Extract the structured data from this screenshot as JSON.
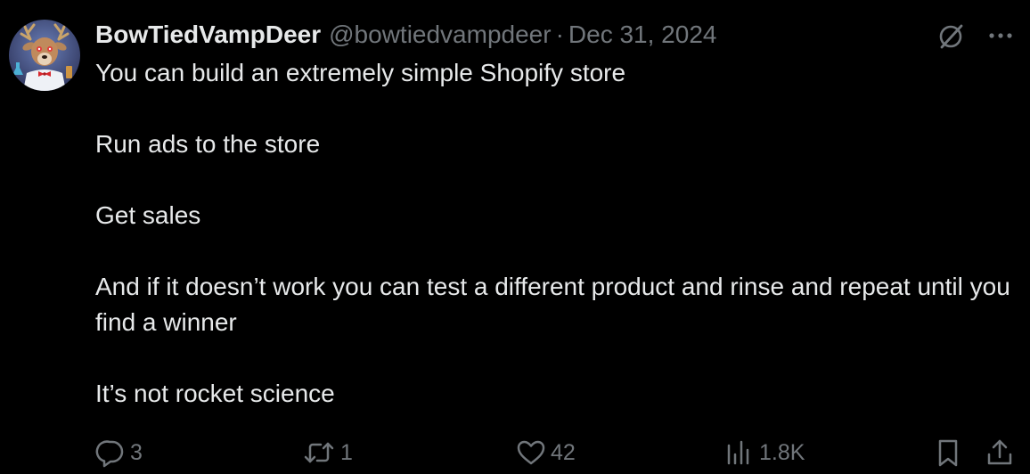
{
  "author": {
    "display_name": "BowTiedVampDeer",
    "handle": "@bowtiedvampdeer",
    "separator": "·",
    "date": "Dec 31, 2024",
    "avatar_icon": "deer-avatar"
  },
  "header_icons": {
    "grok": "grok-slash-icon",
    "more": "more-dots-icon"
  },
  "body": {
    "line1": "You can build an extremely simple Shopify store",
    "line2": "Run ads to the store",
    "line3": "Get sales",
    "line4": "And if it doesn’t work you can test a different product and rinse and repeat until you find a winner",
    "line5": "It’s not rocket science"
  },
  "actions": {
    "replies": "3",
    "retweets": "1",
    "likes": "42",
    "views": "1.8K"
  },
  "colors": {
    "background": "#000000",
    "text": "#e7e9ea",
    "muted": "#71767b"
  }
}
